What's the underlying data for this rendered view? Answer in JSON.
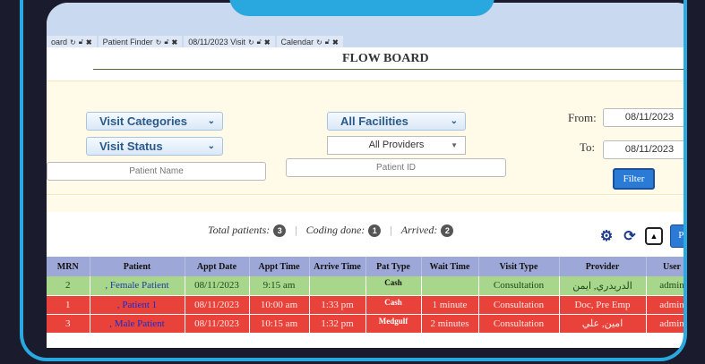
{
  "tabs": [
    {
      "label": "oard"
    },
    {
      "label": "Patient Finder"
    },
    {
      "label": "08/11/2023 Visit"
    },
    {
      "label": "Calendar"
    }
  ],
  "page_title": "FLOW BOARD",
  "filters": {
    "visit_categories": "Visit Categories",
    "visit_status": "Visit Status",
    "facilities": "All Facilities",
    "providers": "All Providers",
    "patient_name_placeholder": "Patient Name",
    "patient_id_placeholder": "Patient ID",
    "from_label": "From:",
    "from_date": "08/11/2023",
    "to_label": "To:",
    "to_date": "08/11/2023",
    "filter_button": "Filter"
  },
  "summary": {
    "total_label": "Total patients:",
    "total_count": "3",
    "coding_label": "Coding done:",
    "coding_count": "1",
    "arrived_label": "Arrived:",
    "arrived_count": "2"
  },
  "print_button": "Print",
  "table": {
    "headers": [
      "MRN",
      "Patient",
      "Appt Date",
      "Appt Time",
      "Arrive Time",
      "Pat Type",
      "Wait Time",
      "Visit Type",
      "Provider",
      "User"
    ],
    "rows": [
      {
        "mrn": "2",
        "patient": ", Female Patient",
        "appt_date": "08/11/2023",
        "appt_time": "9:15 am",
        "arrive_time": "",
        "pat_type": "Cash",
        "wait_time": "",
        "visit_type": "Consultation",
        "provider": "الدريدري, ايمن",
        "user": "admin",
        "status": "green"
      },
      {
        "mrn": "1",
        "patient": ", Patient 1",
        "appt_date": "08/11/2023",
        "appt_time": "10:00 am",
        "arrive_time": "1:33 pm",
        "pat_type": "Cash",
        "wait_time": "1 minute",
        "visit_type": "Consultation",
        "provider": "Doc, Pre Emp",
        "user": "admin",
        "status": "red"
      },
      {
        "mrn": "3",
        "patient": ", Male Patient",
        "appt_date": "08/11/2023",
        "appt_time": "10:15 am",
        "arrive_time": "1:32 pm",
        "pat_type": "Medgulf",
        "wait_time": "2 minutes",
        "visit_type": "Consultation",
        "provider": "امين, علي",
        "user": "admin",
        "status": "red"
      }
    ]
  },
  "colors": {
    "frame": "#2aa9e0",
    "header_row": "#9ea8d8",
    "row_arrived": "#e8423a",
    "row_pending": "#a8d68a"
  }
}
